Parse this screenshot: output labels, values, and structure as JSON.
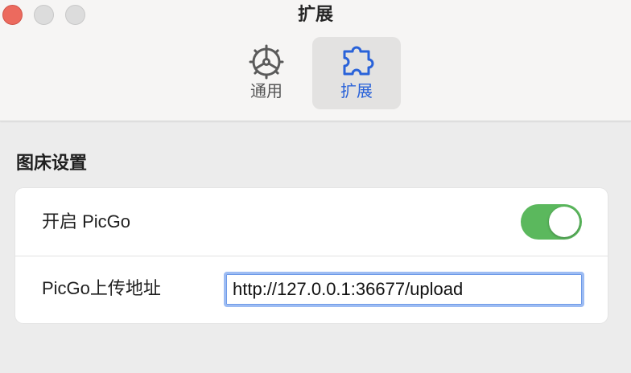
{
  "window": {
    "title": "扩展",
    "traffic_lights": [
      "close",
      "minimize",
      "maximize"
    ],
    "traffic_colors": {
      "close": "#ec6a5e",
      "inactive": "#dcdcdc"
    }
  },
  "toolbar": {
    "tabs": [
      {
        "label": "通用",
        "icon": "gear-icon",
        "selected": false
      },
      {
        "label": "扩展",
        "icon": "puzzle-icon",
        "selected": true
      }
    ],
    "accent_color": "#2962d9"
  },
  "section": {
    "title": "图床设置",
    "rows": [
      {
        "label": "开启 PicGo",
        "control": "toggle",
        "value": true,
        "toggle_color": "#5bb85d"
      },
      {
        "label": "PicGo上传地址",
        "control": "text-input",
        "value": "http://127.0.0.1:36677/upload"
      }
    ]
  }
}
